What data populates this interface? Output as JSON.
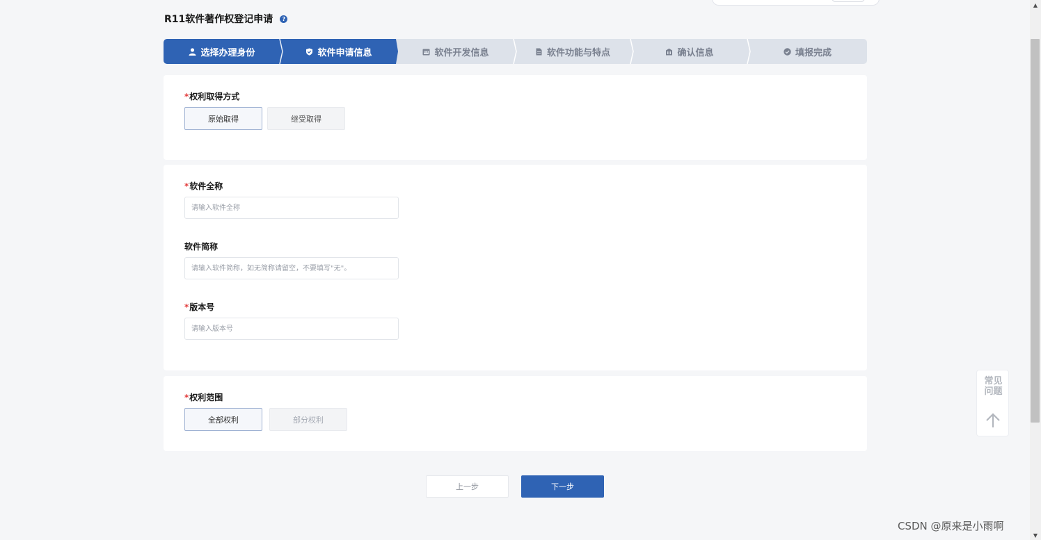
{
  "header": {
    "title": "R11软件著作权登记申请",
    "help_icon": "question-circle-icon"
  },
  "steps": [
    {
      "label": "选择办理身份",
      "icon": "user-icon",
      "state": "done"
    },
    {
      "label": "软件申请信息",
      "icon": "shield-icon",
      "state": "active"
    },
    {
      "label": "软件开发信息",
      "icon": "calendar-icon",
      "state": "pending"
    },
    {
      "label": "软件功能与特点",
      "icon": "document-icon",
      "state": "pending"
    },
    {
      "label": "确认信息",
      "icon": "building-icon",
      "state": "pending"
    },
    {
      "label": "填报完成",
      "icon": "check-circle-icon",
      "state": "pending"
    }
  ],
  "acquisition": {
    "label": "权利取得方式",
    "required": "*",
    "options": [
      {
        "label": "原始取得",
        "selected": true
      },
      {
        "label": "继受取得",
        "selected": false
      }
    ]
  },
  "software": {
    "full_name": {
      "label": "软件全称",
      "required": "*",
      "placeholder": "请输入软件全称",
      "value": ""
    },
    "short_name": {
      "label": "软件简称",
      "placeholder": "请输入软件简称，如无简称请留空，不要填写\"无\"。",
      "value": ""
    },
    "version": {
      "label": "版本号",
      "required": "*",
      "placeholder": "请输入版本号",
      "value": ""
    }
  },
  "scope": {
    "label": "权利范围",
    "required": "*",
    "options": [
      {
        "label": "全部权利",
        "selected": true
      },
      {
        "label": "部分权利",
        "selected": false
      }
    ]
  },
  "actions": {
    "prev_label": "上一步",
    "next_label": "下一步"
  },
  "float_panel": {
    "faq_label": "常见问题",
    "back_to_top_icon": "arrow-up-icon"
  },
  "watermark": "CSDN @原来是小雨啊",
  "colors": {
    "primary": "#2f63b4",
    "required": "#e23b3b",
    "background": "#f5f6f8",
    "step_track": "#dde2ea"
  }
}
